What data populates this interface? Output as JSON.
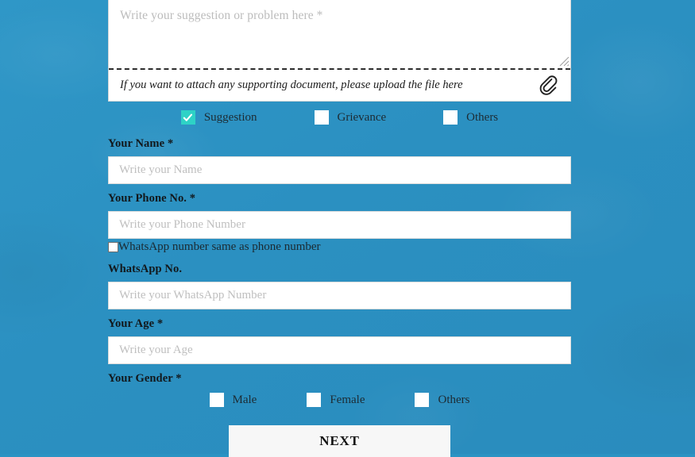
{
  "theme": {
    "background_blue": "#2b93c3",
    "checked_checkbox": "#2ed2c6",
    "input_background": "#ffffff",
    "button_background": "#f7f7f7"
  },
  "suggestion_box": {
    "placeholder": "Write your suggestion or problem here *",
    "value": "",
    "attach_hint": "If you want to attach any supporting document, please upload the file here",
    "attach_icon": "paperclip-icon"
  },
  "topic_options": [
    {
      "label": "Suggestion",
      "checked": true
    },
    {
      "label": "Grievance",
      "checked": false
    },
    {
      "label": "Others",
      "checked": false
    }
  ],
  "fields": {
    "name": {
      "label": "Your Name *",
      "placeholder": "Write your Name",
      "value": ""
    },
    "phone": {
      "label": "Your Phone No. *",
      "placeholder": "Write your Phone Number",
      "value": ""
    },
    "whatsapp_same": {
      "label": "WhatsApp number same as phone number",
      "checked": false
    },
    "whatsapp": {
      "label": "WhatsApp No.",
      "placeholder": "Write your WhatsApp Number",
      "value": ""
    },
    "age": {
      "label": "Your Age *",
      "placeholder": "Write your Age",
      "value": ""
    },
    "gender": {
      "label": "Your Gender *",
      "options": [
        {
          "label": "Male",
          "checked": false
        },
        {
          "label": "Female",
          "checked": false
        },
        {
          "label": "Others",
          "checked": false
        }
      ]
    }
  },
  "actions": {
    "next_label": "NEXT"
  }
}
